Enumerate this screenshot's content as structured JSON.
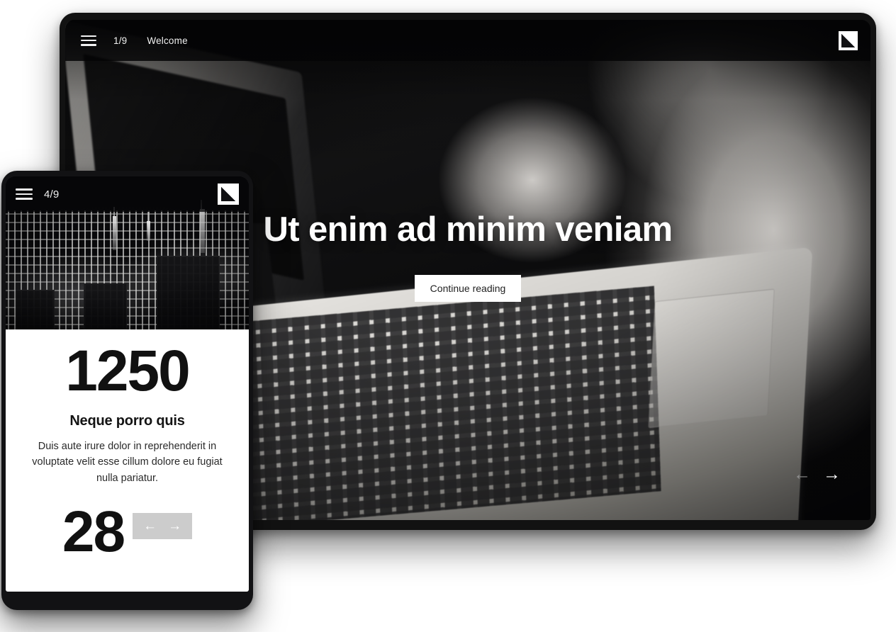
{
  "desktop": {
    "header": {
      "menu_icon": "hamburger-menu-icon",
      "slide_counter": "1/9",
      "slide_title": "Welcome",
      "logo_icon": "brand-logo-icon"
    },
    "hero": {
      "title": "Ut enim ad minim veniam",
      "cta_label": "Continue reading",
      "background_image": "black-and-white-photo-hands-typing-on-laptop"
    },
    "nav": {
      "prev_icon": "arrow-left-icon",
      "prev_glyph": "←",
      "next_icon": "arrow-right-icon",
      "next_glyph": "→"
    }
  },
  "mobile": {
    "header": {
      "menu_icon": "hamburger-menu-icon",
      "slide_counter": "4/9",
      "logo_icon": "brand-logo-icon"
    },
    "hero_image": "black-and-white-night-city-skyline-photo",
    "stat": {
      "number": "1250",
      "heading": "Neque porro quis",
      "body": "Duis aute irure dolor in reprehenderit in voluptate velit esse cillum dolore eu fugiat nulla pariatur."
    },
    "next_stat": {
      "number": "28"
    },
    "nav": {
      "prev_glyph": "←",
      "next_glyph": "→"
    }
  },
  "colors": {
    "page_background": "#ffffff",
    "device_frame": "#121214",
    "screen_dark": "#0a0a0a",
    "text_light": "#f2f2f2",
    "accent_white": "#ffffff",
    "nav_box_gray": "#cccccc",
    "arrow_dim": "#8d8d8d"
  }
}
